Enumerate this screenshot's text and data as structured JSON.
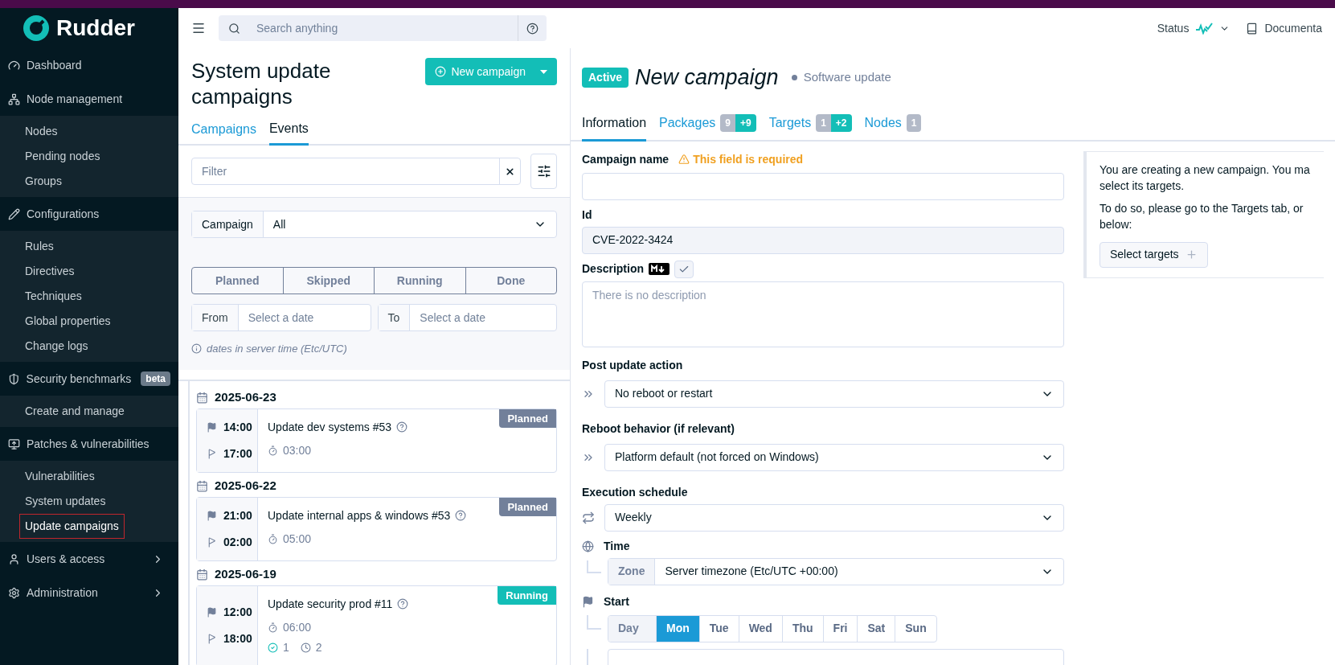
{
  "app": {
    "name": "Rudder"
  },
  "topbar": {
    "search_placeholder": "Search anything",
    "status_label": "Status",
    "docs_label": "Documenta"
  },
  "sidebar": {
    "sections": [
      {
        "label": "Dashboard",
        "expandable": false
      },
      {
        "label": "Node management",
        "expandable": false,
        "children": [
          {
            "label": "Nodes",
            "selected": false
          },
          {
            "label": "Pending nodes",
            "selected": false
          },
          {
            "label": "Groups",
            "selected": false
          }
        ]
      },
      {
        "label": "Configurations",
        "expandable": false,
        "children": [
          {
            "label": "Rules",
            "selected": false
          },
          {
            "label": "Directives",
            "selected": false
          },
          {
            "label": "Techniques",
            "selected": false
          },
          {
            "label": "Global properties",
            "selected": false
          },
          {
            "label": "Change logs",
            "selected": false
          }
        ]
      },
      {
        "label": "Security benchmarks",
        "badge": "beta",
        "expandable": false,
        "children": [
          {
            "label": "Create and manage",
            "selected": false
          }
        ]
      },
      {
        "label": "Patches & vulnerabilities",
        "expandable": false,
        "children": [
          {
            "label": "Vulnerabilities",
            "selected": false
          },
          {
            "label": "System updates",
            "selected": false
          },
          {
            "label": "Update campaigns",
            "selected": true
          }
        ]
      },
      {
        "label": "Users & access",
        "expandable": true
      },
      {
        "label": "Administration",
        "expandable": true
      }
    ]
  },
  "campaigns_panel": {
    "title": "System update campaigns",
    "new_button": "New campaign",
    "tabs": [
      {
        "label": "Campaigns",
        "selected": false
      },
      {
        "label": "Events",
        "selected": true
      }
    ],
    "filter_placeholder": "Filter",
    "campaign_select": {
      "label": "Campaign",
      "value": "All"
    },
    "status_buttons": [
      "Planned",
      "Skipped",
      "Running",
      "Done"
    ],
    "from": {
      "label": "From",
      "placeholder": "Select a date"
    },
    "to": {
      "label": "To",
      "placeholder": "Select a date"
    },
    "hint": "dates in server time (Etc/UTC)",
    "events": [
      {
        "date": "2025-06-23",
        "items": [
          {
            "start": "14:00",
            "end": "17:00",
            "title": "Update dev systems #53",
            "duration": "03:00",
            "status": {
              "label": "Planned",
              "kind": "planned"
            }
          }
        ]
      },
      {
        "date": "2025-06-22",
        "items": [
          {
            "start": "21:00",
            "end": "02:00",
            "title": "Update internal apps & windows #53",
            "duration": "05:00",
            "status": {
              "label": "Planned",
              "kind": "planned"
            }
          }
        ]
      },
      {
        "date": "2025-06-19",
        "items": [
          {
            "start": "12:00",
            "end": "18:00",
            "title": "Update security prod #11",
            "duration": "06:00",
            "status": {
              "label": "Running",
              "kind": "running"
            },
            "success_count": "1",
            "pending_count": "2"
          }
        ]
      }
    ]
  },
  "campaign": {
    "status": "Active",
    "title": "New campaign",
    "type": "Software update",
    "tabs": [
      {
        "label": "Information",
        "selected": true
      },
      {
        "label": "Packages",
        "selected": false,
        "counts": [
          {
            "text": "9",
            "kind": "total"
          },
          {
            "text": "+9",
            "kind": "added"
          }
        ]
      },
      {
        "label": "Targets",
        "selected": false,
        "counts": [
          {
            "text": "1",
            "kind": "total"
          },
          {
            "text": "+2",
            "kind": "added"
          }
        ]
      },
      {
        "label": "Nodes",
        "selected": false,
        "counts": [
          {
            "text": "1",
            "kind": "total"
          }
        ]
      }
    ],
    "form": {
      "name_label": "Campaign name",
      "name_warning": "This field is required",
      "id_label": "Id",
      "id_value": "CVE-2022-3424",
      "description_label": "Description",
      "description_placeholder": "There is no description",
      "post_update_label": "Post update action",
      "post_update_value": "No reboot or restart",
      "reboot_label": "Reboot behavior (if relevant)",
      "reboot_value": "Platform default (not forced on Windows)",
      "schedule_label": "Execution schedule",
      "schedule_value": "Weekly",
      "time_label": "Time",
      "zone_label": "Zone",
      "zone_value": "Server timezone (Etc/UTC +00:00)",
      "start_label": "Start",
      "day_label": "Day",
      "days": [
        {
          "label": "Mon",
          "selected": true
        },
        {
          "label": "Tue",
          "selected": false
        },
        {
          "label": "Wed",
          "selected": false
        },
        {
          "label": "Thu",
          "selected": false
        },
        {
          "label": "Fri",
          "selected": false
        },
        {
          "label": "Sat",
          "selected": false
        },
        {
          "label": "Sun",
          "selected": false
        }
      ]
    },
    "info": {
      "paragraphs": [
        [
          "You are creating a new campaign. You ma",
          "select its targets."
        ],
        [
          "To do so, please go to the Targets tab, or",
          "below:"
        ]
      ],
      "button": "Select targets"
    }
  }
}
